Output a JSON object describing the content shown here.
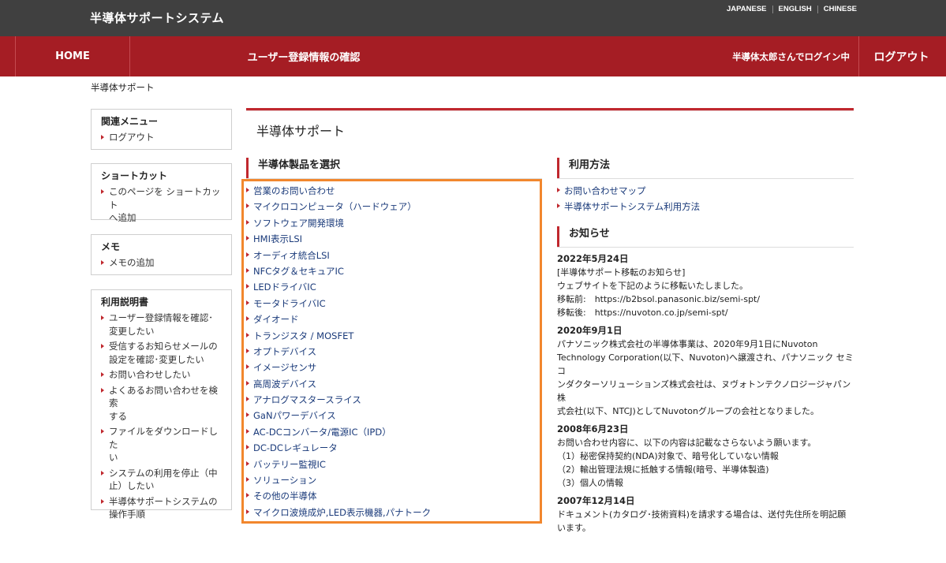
{
  "header": {
    "site_title": "半導体サポートシステム",
    "languages": [
      "JAPANESE",
      "ENGLISH",
      "CHINESE"
    ]
  },
  "nav": {
    "home": "HOME",
    "confirm": "ユーザー登録情報の確認",
    "user_status": "半導体太郎さんでログイン中",
    "logout": "ログアウト"
  },
  "breadcrumb": "半導体サポート",
  "sidebar": {
    "related": {
      "title": "関連メニュー",
      "items": [
        "ログアウト"
      ]
    },
    "shortcut": {
      "title": "ショートカット",
      "items": [
        "このページを ショートカット\nへ追加"
      ]
    },
    "memo": {
      "title": "メモ",
      "items": [
        "メモの追加"
      ]
    },
    "manual": {
      "title": "利用説明書",
      "items": [
        "ユーザー登録情報を確認･\n変更したい",
        "受信するお知らせメールの\n設定を確認･変更したい",
        "お問い合わせしたい",
        "よくあるお問い合わせを検索\nする",
        "ファイルをダウンロードした\nい",
        "システムの利用を停止（中\n止）したい",
        "半導体サポートシステムの\n操作手順"
      ]
    }
  },
  "main": {
    "title": "半導体サポート",
    "products_heading": "半導体製品を選択",
    "products": [
      "営業のお問い合わせ",
      "マイクロコンピュータ（ハードウェア）",
      "ソフトウェア開発環境",
      "HMI表示LSI",
      "オーディオ統合LSI",
      "NFCタグ＆セキュアIC",
      "LEDドライバIC",
      "モータドライバIC",
      "ダイオード",
      "トランジスタ / MOSFET",
      "オプトデバイス",
      "イメージセンサ",
      "高周波デバイス",
      "アナログマスタースライス",
      "GaNパワーデバイス",
      "AC-DCコンバータ/電源IC（IPD）",
      "DC-DCレギュレータ",
      "バッテリー監視IC",
      "ソリューション",
      "その他の半導体",
      "マイクロ波焼成炉,LED表示機器,パナトーク"
    ],
    "usage_heading": "利用方法",
    "usage_links": [
      "お問い合わせマップ",
      "半導体サポートシステム利用方法"
    ],
    "news_heading": "お知らせ",
    "news": [
      {
        "date": "2022年5月24日",
        "body": "[半導体サポート移転のお知らせ]\nウェブサイトを下記のように移転いたしました。\n移転前:　https://b2bsol.panasonic.biz/semi-spt/\n移転後:　https://nuvoton.co.jp/semi-spt/"
      },
      {
        "date": "2020年9月1日",
        "body": "パナソニック株式会社の半導体事業は、2020年9月1日にNuvoton\nTechnology Corporation(以下、Nuvoton)へ譲渡され、パナソニック セミコ\nンダクターソリューションズ株式会社は、ヌヴォトンテクノロジージャパン株\n式会社(以下、NTCJ)としてNuvotonグループの会社となりました。"
      },
      {
        "date": "2008年6月23日",
        "body": "お問い合わせ内容に、以下の内容は記載なさらないよう願います。\n（1）秘密保持契約(NDA)対象で、暗号化していない情報\n（2）輸出管理法規に抵触する情報(暗号、半導体製造)\n（3）個人の情報"
      },
      {
        "date": "2007年12月14日",
        "body": "ドキュメント(カタログ･技術資料)を請求する場合は、送付先住所を明記願\nいます。"
      }
    ]
  },
  "colors": {
    "header_bg": "#404040",
    "nav_red": "#a51d24",
    "highlight_orange": "#f2872d",
    "link_blue": "#1a3a7a"
  }
}
